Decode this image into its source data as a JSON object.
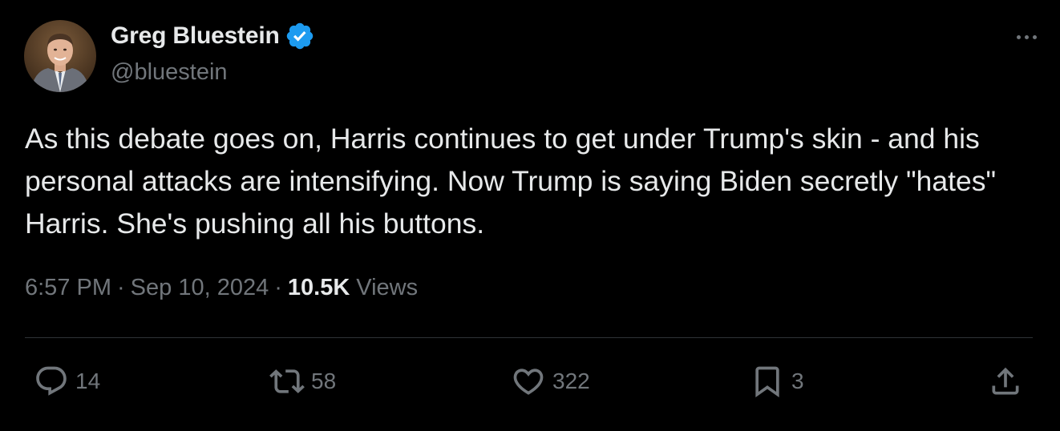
{
  "author": {
    "name": "Greg Bluestein",
    "handle": "@bluestein",
    "verified": true,
    "avatar_icon": "profile-photo"
  },
  "tweet": {
    "text": "As this debate goes on, Harris continues to get under Trump's skin - and his personal attacks are intensifying. Now Trump is saying Biden secretly \"hates\" Harris. She's pushing all his buttons.",
    "time": "6:57 PM",
    "date": "Sep 10, 2024",
    "separator": "·",
    "views_count": "10.5K",
    "views_label": "Views"
  },
  "actions": {
    "reply": {
      "icon": "reply-icon",
      "count": "14"
    },
    "retweet": {
      "icon": "retweet-icon",
      "count": "58"
    },
    "like": {
      "icon": "heart-icon",
      "count": "322"
    },
    "bookmark": {
      "icon": "bookmark-icon",
      "count": "3"
    },
    "share": {
      "icon": "share-icon"
    }
  },
  "colors": {
    "background": "#000000",
    "text": "#e7e9ea",
    "muted": "#71767b",
    "verified": "#1d9bf0",
    "divider": "#2f3336"
  }
}
